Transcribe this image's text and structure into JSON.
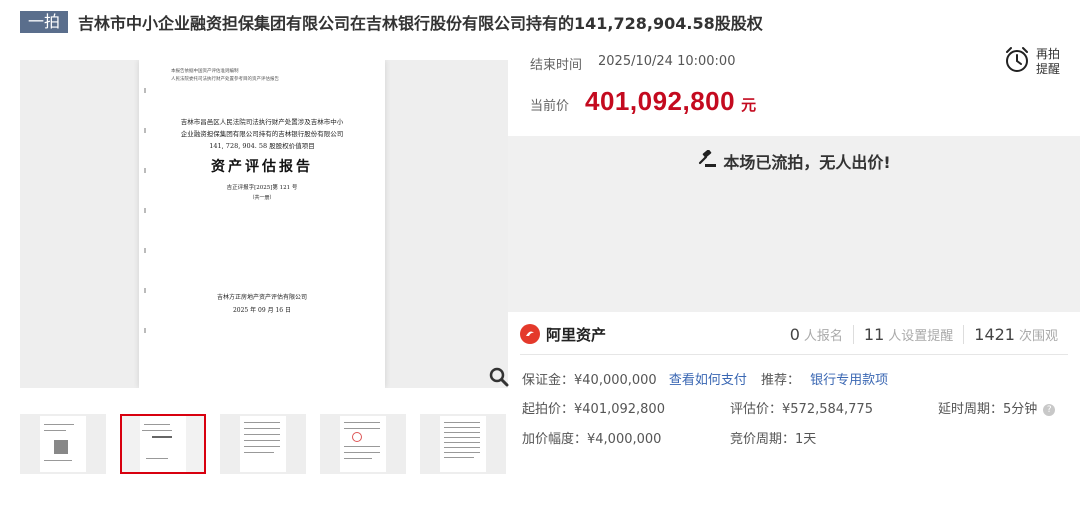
{
  "title": {
    "badge": "一拍",
    "text": "吉林市中小企业融资担保集团有限公司在吉林银行股份有限公司持有的141,728,904.58股股权"
  },
  "document": {
    "header_line1": "本报告依据中国资产评估准则编制",
    "header_line2": "人民法院委托司法执行财产处置参考目的资产评估报告",
    "line1": "吉林市昌邑区人民法院司法执行财产处置涉及吉林市中小",
    "line2": "企业融资担保集团有限公司持有的吉林银行股份有限公司",
    "line3": "141, 728, 904. 58 股股权价值项目",
    "big_title": "资产评估报告",
    "doc_no": "吉正评报字[2025]第 121 号",
    "volume": "（共一册）",
    "company": "吉林方正房地产资产评估有限公司",
    "date": "2025 年 09 月 16 日"
  },
  "auction": {
    "end_label": "结束时间",
    "end_value": "2025/10/24 10:00:00",
    "remind_line1": "再拍",
    "remind_line2": "提醒",
    "price_label": "当前价",
    "price_value": "401,092,800",
    "price_unit": "元",
    "status_message": "本场已流拍，无人出价!"
  },
  "platform": {
    "logo_text": "阿里资产",
    "stats": [
      {
        "num": "0",
        "label": "人报名"
      },
      {
        "num": "11",
        "label": "人设置提醒"
      },
      {
        "num": "1421",
        "label": "次围观"
      }
    ]
  },
  "details": {
    "deposit": "保证金：¥40,000,000",
    "how_to_pay": "查看如何支付",
    "recommend_label": "推荐：",
    "recommend_link": "银行专用款项",
    "start_price": "起拍价：¥401,092,800",
    "eval_price": "评估价：¥572,584,775",
    "delay": "延时周期：5分钟",
    "increment": "加价幅度：¥4,000,000",
    "bid_period": "竞价周期：1天"
  },
  "colors": {
    "accent_red": "#c40a1f",
    "badge_bg": "#5a6e8c",
    "link_blue": "#3a67b3"
  }
}
